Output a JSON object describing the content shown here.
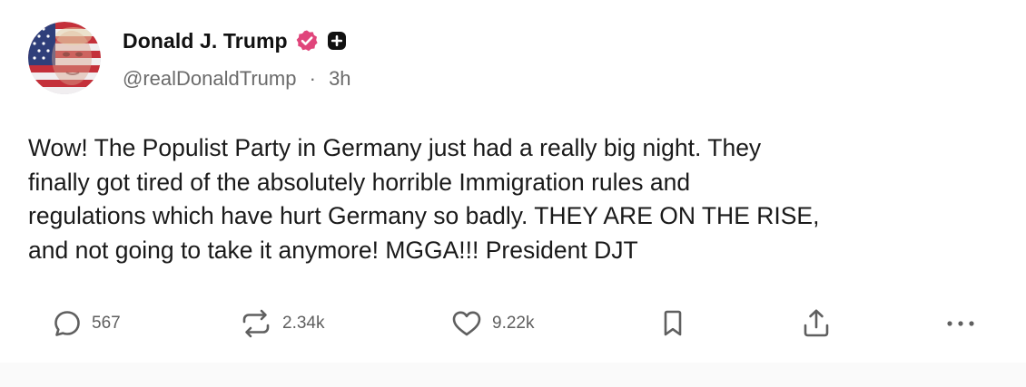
{
  "post": {
    "author": {
      "display_name": "Donald J. Trump",
      "handle": "@realDonaldTrump",
      "separator": "·",
      "time_ago": "3h",
      "avatar_icon": "avatar-flag-portrait",
      "verified_icon": "verified-badge-icon",
      "verified_color": "#e0457b",
      "plus_icon": "plus-badge-icon"
    },
    "text": "Wow! The Populist Party in Germany just had a really big night. They\nfinally got tired of the absolutely horrible Immigration rules and\nregulations which have hurt Germany so badly. THEY ARE ON THE RISE,\nand not going to take it anymore! MGGA!!! President DJT",
    "actions": {
      "reply": {
        "icon": "reply-icon",
        "count": "567"
      },
      "retruth": {
        "icon": "retruth-icon",
        "count": "2.34k"
      },
      "like": {
        "icon": "heart-icon",
        "count": "9.22k"
      },
      "bookmark": {
        "icon": "bookmark-icon"
      },
      "share": {
        "icon": "share-icon"
      },
      "more": {
        "icon": "more-icon"
      }
    }
  }
}
